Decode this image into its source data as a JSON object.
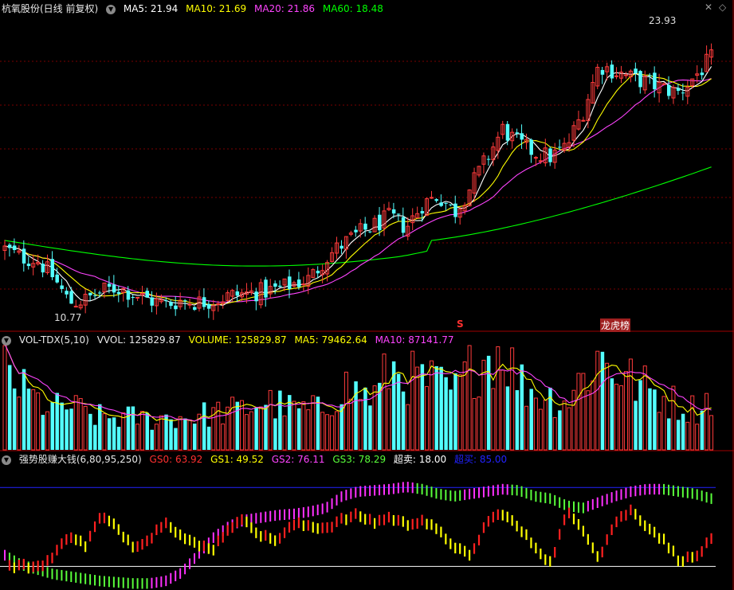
{
  "colors": {
    "up": "#ff3b3b",
    "down": "#53ffff",
    "ma5": "#ffffff",
    "ma10": "#ffff00",
    "ma20": "#ff44ff",
    "ma60": "#00ff00",
    "divider": "#a00000",
    "grid": "#7a0000",
    "gs_green": "#59ff3a",
    "gs_red": "#ff2020",
    "gs_yellow": "#ffff00",
    "gs_magenta": "#ff30ff",
    "blue_line": "#2222ff",
    "white_line": "#ffffff"
  },
  "main": {
    "title": "杭氧股份(日线 前复权)",
    "ma5": "MA5: 21.94",
    "ma10": "MA10: 21.69",
    "ma20": "MA20: 21.86",
    "ma60": "MA60: 18.48",
    "high_label": "23.93",
    "low_label": "10.77",
    "marker_s": "S",
    "marker_lhb": "龙虎榜",
    "right_icons": [
      "close-icon",
      "diamond-icon"
    ]
  },
  "vol": {
    "title": "VOL-TDX(5,10)",
    "vvol": "VVOL: 125829.87",
    "volume": "VOLUME: 125829.87",
    "ma5": "MA5: 79462.64",
    "ma10": "MA10: 87141.77"
  },
  "ind": {
    "title": "强势股赚大钱(6,80,95,250)",
    "gs0": "GS0: 63.92",
    "gs1": "GS1: 49.52",
    "gs2": "GS2: 76.11",
    "gs3": "GS3: 78.29",
    "chaomai": "超卖: 18.00",
    "chaomai2": "超买: 85.00"
  },
  "chart_data": {
    "type": "candlestick",
    "price_range": [
      10.0,
      24.6
    ],
    "volume_range": [
      0,
      260000
    ],
    "indicator_range": [
      0,
      100
    ],
    "high_price": 23.93,
    "low_price": 10.77,
    "overbought": 85,
    "oversold": 18,
    "ma60_last": 18.48,
    "price_path": [
      13.7,
      13.3,
      13.2,
      12.4,
      11.2,
      11.3,
      11.7,
      11.9,
      11.6,
      11.3,
      11.1,
      11.3,
      11.2,
      11.3,
      11.5,
      11.6,
      11.7,
      11.8,
      12.1,
      12.3,
      13.3,
      13.9,
      14.4,
      14.8,
      15.2,
      14.7,
      15.8,
      16.2,
      15.4,
      16.6,
      17.9,
      19.3,
      18.6,
      18.2,
      18.0,
      18.5,
      20.1,
      22.3,
      22.0,
      21.7,
      21.5,
      21.2,
      21.0,
      21.8,
      22.6
    ],
    "vol_profile": [
      200000,
      150000,
      120000,
      100000,
      110000,
      90000,
      80000,
      80000,
      80000,
      75000,
      80000,
      80000,
      85000,
      90000,
      95000,
      100000,
      120000,
      110000,
      100000,
      95000,
      105000,
      160000,
      140000,
      130000,
      200000,
      180000,
      170000,
      160000,
      140000,
      200000,
      230000,
      250000,
      170000,
      140000,
      130000,
      120000,
      180000,
      230000,
      200000,
      170000,
      150000,
      130000,
      110000,
      100000,
      130000
    ],
    "gs_path": [
      22,
      23,
      22,
      30,
      50,
      40,
      65,
      55,
      40,
      45,
      62,
      48,
      40,
      38,
      56,
      62,
      48,
      45,
      58,
      57,
      55,
      62,
      66,
      60,
      64,
      58,
      62,
      52,
      40,
      30,
      60,
      68,
      55,
      40,
      25,
      68,
      55,
      30,
      60,
      70,
      57,
      45,
      28,
      30,
      45
    ],
    "trend_path": [
      30,
      22,
      18,
      14,
      12,
      10,
      8,
      7,
      6,
      6,
      8,
      15,
      30,
      45,
      55,
      60,
      62,
      64,
      65,
      67,
      70,
      80,
      84,
      85,
      86,
      88,
      86,
      82,
      80,
      82,
      84,
      86,
      85,
      80,
      78,
      72,
      70,
      75,
      80,
      84,
      86,
      86,
      84,
      82,
      78
    ]
  }
}
